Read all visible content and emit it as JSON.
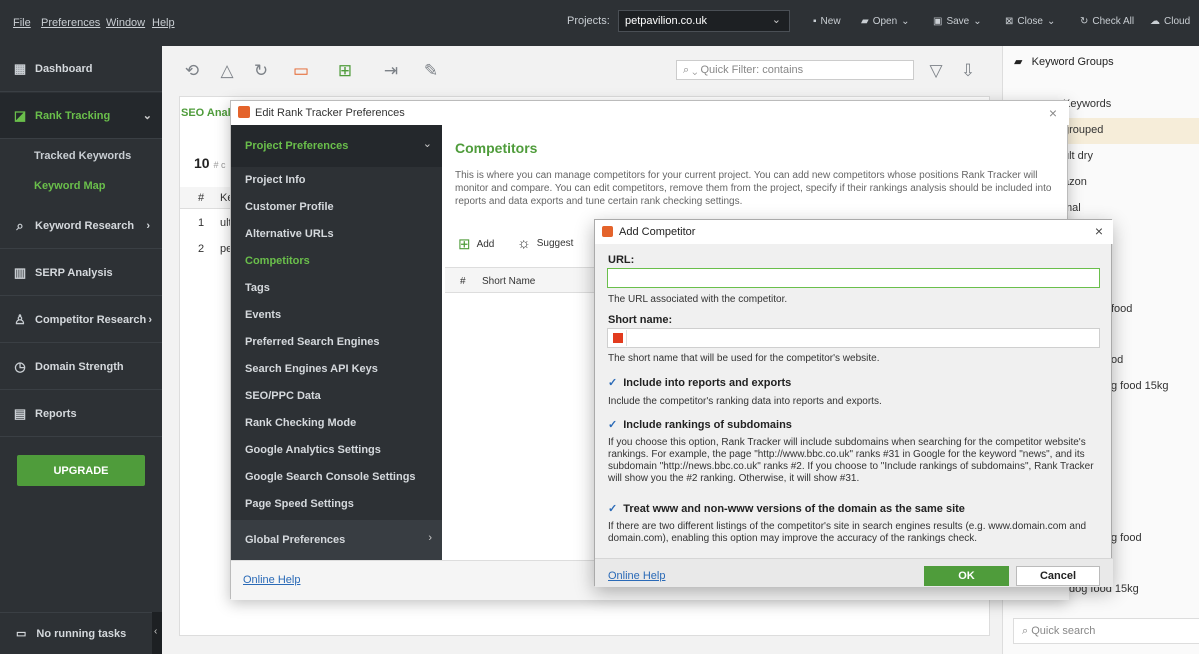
{
  "menu": {
    "file": "File",
    "preferences": "Preferences",
    "window": "Window",
    "help": "Help"
  },
  "project": {
    "label": "Projects:",
    "value": "petpavilion.co.uk"
  },
  "toolbar_right": {
    "new": "New",
    "open": "Open",
    "save": "Save",
    "close": "Close",
    "check_all": "Check All",
    "cloud": "Cloud"
  },
  "sidebar": {
    "items": [
      {
        "label": "Dashboard"
      },
      {
        "label": "Rank Tracking"
      },
      {
        "label": "Keyword Research"
      },
      {
        "label": "SERP Analysis"
      },
      {
        "label": "Competitor Research"
      },
      {
        "label": "Domain Strength"
      },
      {
        "label": "Reports"
      }
    ],
    "sub_items": [
      "Tracked Keywords",
      "Keyword Map"
    ],
    "upgrade": "UPGRADE",
    "status": "No running tasks"
  },
  "main": {
    "quick_filter": "Quick Filter: contains",
    "tab": "SEO Analy",
    "count": "10",
    "count_suffix": "# c",
    "col_num": "#",
    "col_kw": "Ke",
    "rows": [
      {
        "n": "1",
        "kw": "ult"
      },
      {
        "n": "2",
        "kw": "pe"
      }
    ]
  },
  "right_panel": {
    "title": "Keyword Groups",
    "items": [
      "Keywords",
      "grouped",
      "ult dry",
      "azon",
      "mal",
      "food",
      "od",
      "g food 15kg",
      "g food",
      "dog food 15kg"
    ],
    "search_placeholder": "Quick search"
  },
  "prefs_dialog": {
    "title": "Edit Rank Tracker Preferences",
    "section_header": "Project Preferences",
    "nav": [
      "Project Info",
      "Customer Profile",
      "Alternative URLs",
      "Competitors",
      "Tags",
      "Events",
      "Preferred Search Engines",
      "Search Engines API Keys",
      "SEO/PPC Data",
      "Rank Checking Mode",
      "Google Analytics Settings",
      "Google Search Console Settings",
      "Page Speed Settings"
    ],
    "global": "Global Preferences",
    "heading": "Competitors",
    "description": "This is where you can manage competitors for your current project. You can add new competitors whose positions Rank Tracker will monitor and compare. You can edit competitors, remove them from the project, specify if their rankings analysis should be included into reports and data exports and tune certain rank checking settings.",
    "add": "Add",
    "suggest": "Suggest",
    "col_num": "#",
    "col_short": "Short Name",
    "help": "Online Help"
  },
  "add_dialog": {
    "title": "Add Competitor",
    "url_label": "URL:",
    "url_value": "",
    "url_hint": "The URL associated with the competitor.",
    "short_label": "Short name:",
    "short_value": "",
    "short_hint": "The short name that will be used for the competitor's website.",
    "opt1": "Include into reports and exports",
    "opt1_hint": "Include the competitor's ranking data into reports and exports.",
    "opt2": "Include rankings of subdomains",
    "opt2_hint": "If you choose this option, Rank Tracker will include subdomains when searching for the competitor website's rankings. For example, the page \"http://www.bbc.co.uk\" ranks #31 in Google for the keyword \"news\", and its subdomain \"http://news.bbc.co.uk\" ranks #2. If you choose to \"Include rankings of subdomains\", Rank Tracker will show you the #2 ranking. Otherwise, it will show #31.",
    "opt3": "Treat www and non-www versions of the domain as the same site",
    "opt3_hint": "If there are two different listings of the competitor's site in search engines results (e.g. www.domain.com and domain.com), enabling this option may improve the accuracy of the rankings check.",
    "help": "Online Help",
    "ok": "OK",
    "cancel": "Cancel"
  }
}
